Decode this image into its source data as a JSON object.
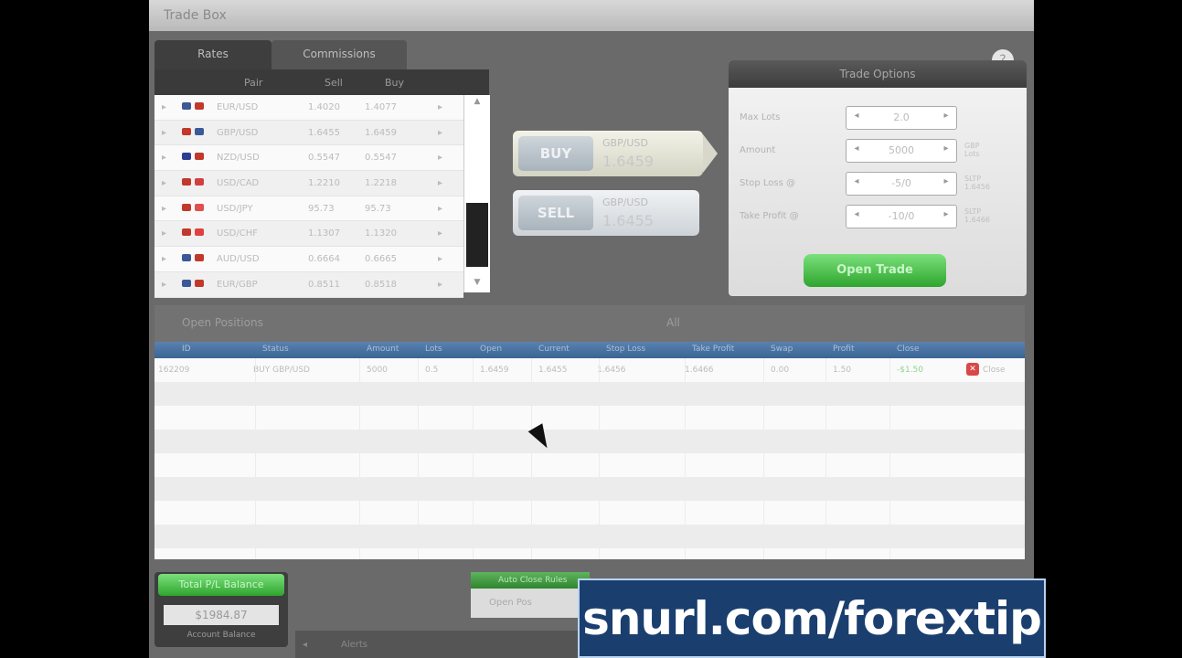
{
  "window": {
    "title": "Trade Box"
  },
  "quotes_panel": {
    "tabs": [
      "Rates",
      "Commissions"
    ],
    "columns": [
      "Pair",
      "Sell",
      "Buy"
    ],
    "rows": [
      {
        "pair": "EUR/USD",
        "sell": "1.4020",
        "buy": "1.4077",
        "flag1": "#3b5998",
        "flag2": "#c0392b"
      },
      {
        "pair": "GBP/USD",
        "sell": "1.6455",
        "buy": "1.6459",
        "flag1": "#c0392b",
        "flag2": "#3b5998"
      },
      {
        "pair": "NZD/USD",
        "sell": "0.5547",
        "buy": "0.5547",
        "flag1": "#2c3e90",
        "flag2": "#c0392b"
      },
      {
        "pair": "USD/CAD",
        "sell": "1.2210",
        "buy": "1.2218",
        "flag1": "#c0392b",
        "flag2": "#d04040"
      },
      {
        "pair": "USD/JPY",
        "sell": "95.73",
        "buy": "95.73",
        "flag1": "#c0392b",
        "flag2": "#e05050"
      },
      {
        "pair": "USD/CHF",
        "sell": "1.1307",
        "buy": "1.1320",
        "flag1": "#c0392b",
        "flag2": "#e04040"
      },
      {
        "pair": "AUD/USD",
        "sell": "0.6664",
        "buy": "0.6665",
        "flag1": "#3b5998",
        "flag2": "#c0392b"
      },
      {
        "pair": "EUR/GBP",
        "sell": "0.8511",
        "buy": "0.8518",
        "flag1": "#3b5998",
        "flag2": "#c0392b"
      }
    ]
  },
  "buy_button": {
    "label": "BUY",
    "pair": "GBP/USD",
    "price": "1.6459"
  },
  "sell_button": {
    "label": "SELL",
    "pair": "GBP/USD",
    "price": "1.6455"
  },
  "trade_options": {
    "title": "Trade Options",
    "help_label": "?",
    "fields": [
      {
        "label": "Max Lots",
        "value": "2.0",
        "unit1": "",
        "unit2": ""
      },
      {
        "label": "Amount",
        "value": "5000",
        "unit1": "GBP",
        "unit2": "Lots"
      },
      {
        "label": "Stop Loss @",
        "value": "-5/0",
        "unit1": "SLTP",
        "unit2": "1.6456"
      },
      {
        "label": "Take Profit @",
        "value": "-10/0",
        "unit1": "SLTP",
        "unit2": "1.6466"
      }
    ],
    "open_trade_label": "Open Trade"
  },
  "open_positions": {
    "title": "Open Positions",
    "filter_label": "All",
    "columns": [
      "ID",
      "Status",
      "Amount",
      "Lots",
      "Open",
      "Current",
      "Stop Loss",
      "Take Profit",
      "Swap",
      "Profit",
      "Close"
    ],
    "row": {
      "id": "162209",
      "side": "BUY GBP/USD",
      "amount": "5000",
      "lots": "0.5",
      "open": "1.6459",
      "current": "1.6455",
      "sl": "1.6456",
      "tp": "1.6466",
      "swap": "0.00",
      "pips": "1.50",
      "profit": "-$1.50",
      "close": "Close"
    }
  },
  "account": {
    "balance_title": "Total P/L Balance",
    "balance": "$1984.87",
    "label": "Account Balance"
  },
  "center_box": {
    "top_label": "Auto Close Rules",
    "bottom_label": "Open Pos"
  },
  "footer": {
    "icon": "◂",
    "label": "Alerts"
  },
  "banner": {
    "text": "snurl.com/forextip"
  }
}
